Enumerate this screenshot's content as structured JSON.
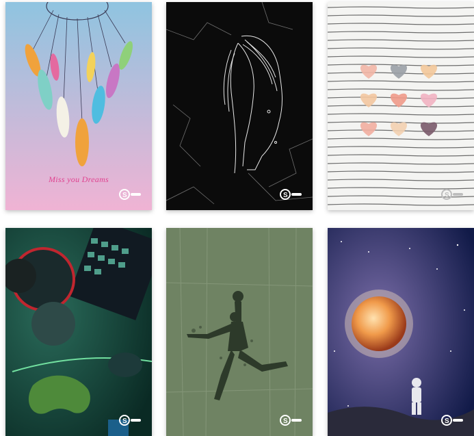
{
  "covers": [
    {
      "id": "dreamcatcher",
      "tagline": "Miss you Dreams",
      "brand": "S"
    },
    {
      "id": "marble-horse",
      "brand": "S"
    },
    {
      "id": "striped-hearts",
      "brand": "S"
    },
    {
      "id": "gaming",
      "brand": "S"
    },
    {
      "id": "basketball",
      "brand": "S"
    },
    {
      "id": "astronaut",
      "brand": "S"
    }
  ],
  "colors": {
    "dreamcatcher_top": "#8fc4e0",
    "dreamcatcher_bottom": "#f0b3d4",
    "marble": "#0b0b0b",
    "stripes_bg": "#f4f4f2",
    "gaming_bg": "#0e3a32",
    "basketball_bg": "#6f8363",
    "space_bg": "#1d2c63",
    "tagline": "#e0428f"
  },
  "icons": [
    "brand-logo-icon"
  ]
}
